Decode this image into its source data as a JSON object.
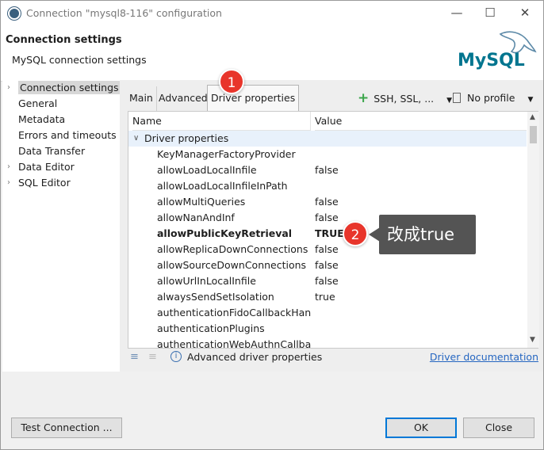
{
  "window": {
    "title": "Connection \"mysql8-116\" configuration",
    "minimize": "—",
    "maximize": "☐",
    "close": "✕"
  },
  "header": {
    "title": "Connection settings",
    "subtitle": "MySQL connection settings",
    "logo_text": "MySQL"
  },
  "nav": {
    "items": [
      {
        "label": "Connection settings",
        "expandable": true,
        "selected": true
      },
      {
        "label": "General",
        "expandable": false
      },
      {
        "label": "Metadata",
        "expandable": false
      },
      {
        "label": "Errors and timeouts",
        "expandable": false
      },
      {
        "label": "Data Transfer",
        "expandable": false
      },
      {
        "label": "Data Editor",
        "expandable": true
      },
      {
        "label": "SQL Editor",
        "expandable": true
      }
    ]
  },
  "tabs": [
    {
      "label": "Main"
    },
    {
      "label": "Advanced"
    },
    {
      "label": "Driver properties",
      "active": true
    }
  ],
  "toolbar": {
    "ssh_label": "SSH, SSL, ...",
    "profile_label": "No profile"
  },
  "table": {
    "col_name": "Name",
    "col_value": "Value",
    "group_label": "Driver properties",
    "rows": [
      {
        "name": "KeyManagerFactoryProvider",
        "value": ""
      },
      {
        "name": "allowLoadLocalInfile",
        "value": "false"
      },
      {
        "name": "allowLoadLocalInfileInPath",
        "value": ""
      },
      {
        "name": "allowMultiQueries",
        "value": "false"
      },
      {
        "name": "allowNanAndInf",
        "value": "false"
      },
      {
        "name": "allowPublicKeyRetrieval",
        "value": "TRUE",
        "bold": true
      },
      {
        "name": "allowReplicaDownConnections",
        "value": "false"
      },
      {
        "name": "allowSourceDownConnections",
        "value": "false"
      },
      {
        "name": "allowUrlInLocalInfile",
        "value": "false"
      },
      {
        "name": "alwaysSendSetIsolation",
        "value": "true"
      },
      {
        "name": "authenticationFidoCallbackHandler",
        "value": ""
      },
      {
        "name": "authenticationPlugins",
        "value": ""
      },
      {
        "name": "authenticationWebAuthnCallbackHandler",
        "value": ""
      }
    ]
  },
  "bottom": {
    "advanced_label": "Advanced driver properties",
    "doc_link": "Driver documentation"
  },
  "buttons": {
    "test": "Test Connection ...",
    "ok": "OK",
    "close": "Close"
  },
  "annotations": {
    "badge1": "1",
    "badge2": "2",
    "callout": "改成true"
  },
  "colors": {
    "accent": "#0078d7",
    "badge": "#e8352b",
    "link": "#2566c1",
    "selection": "#e8f1fb"
  },
  "icons": {
    "add": "plus-icon",
    "doc": "document-icon",
    "expand": "chevron-down-icon",
    "info": "info-icon"
  }
}
